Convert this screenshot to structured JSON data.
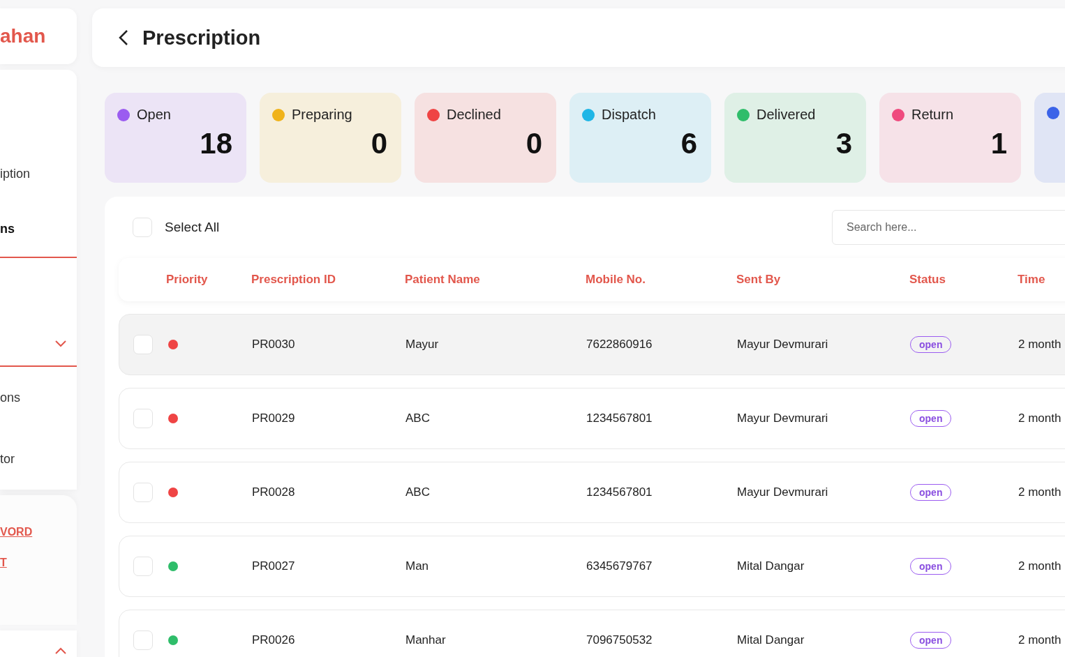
{
  "sidebar": {
    "logo": "ahan",
    "items": [
      {
        "kind": "link",
        "label": "iption",
        "selected": false
      },
      {
        "kind": "link",
        "label": "ns",
        "selected": true
      },
      {
        "kind": "dropdown",
        "expanded": false
      },
      {
        "kind": "link",
        "label": "ons",
        "selected": false
      },
      {
        "kind": "link",
        "label": "tor",
        "selected": false
      }
    ],
    "account_links": [
      "VORD",
      "T"
    ],
    "footer": {
      "expanded": true
    }
  },
  "header": {
    "title": "Prescription"
  },
  "status_cards": [
    {
      "label": "Open",
      "count": "18",
      "color": "#9b5cf0"
    },
    {
      "label": "Preparing",
      "count": "0",
      "color": "#f0b31a"
    },
    {
      "label": "Declined",
      "count": "0",
      "color": "#ef4444"
    },
    {
      "label": "Dispatch",
      "count": "6",
      "color": "#1fb6e6"
    },
    {
      "label": "Delivered",
      "count": "3",
      "color": "#2fbd6a"
    },
    {
      "label": "Return",
      "count": "1",
      "color": "#ef4a7e"
    },
    {
      "color": "#3b63e8"
    }
  ],
  "table": {
    "select_all": {
      "label": "Select All",
      "checked": false
    },
    "search": {
      "placeholder": "Search here..."
    },
    "columns": [
      "Priority",
      "Prescription ID",
      "Patient Name",
      "Mobile No.",
      "Sent By",
      "Status",
      "Time"
    ],
    "rows": [
      {
        "checked": false,
        "highlighted": true,
        "color": "#ef4444",
        "id": "PR0030",
        "patient": "Mayur",
        "mobile": "7622860916",
        "sent_by": "Mayur Devmurari",
        "status": "open",
        "time": "2 month"
      },
      {
        "checked": false,
        "highlighted": false,
        "color": "#ef4444",
        "id": "PR0029",
        "patient": "ABC",
        "mobile": "1234567801",
        "sent_by": "Mayur Devmurari",
        "status": "open",
        "time": "2 month"
      },
      {
        "checked": false,
        "highlighted": false,
        "color": "#ef4444",
        "id": "PR0028",
        "patient": "ABC",
        "mobile": "1234567801",
        "sent_by": "Mayur Devmurari",
        "status": "open",
        "time": "2 month"
      },
      {
        "checked": false,
        "highlighted": false,
        "color": "#2fbd6a",
        "id": "PR0027",
        "patient": "Man",
        "mobile": "6345679767",
        "sent_by": "Mital Dangar",
        "status": "open",
        "time": "2 month"
      },
      {
        "checked": false,
        "highlighted": false,
        "color": "#2fbd6a",
        "id": "PR0026",
        "patient": "Manhar",
        "mobile": "7096750532",
        "sent_by": "Mital Dangar",
        "status": "open",
        "time": "2 month"
      }
    ]
  }
}
